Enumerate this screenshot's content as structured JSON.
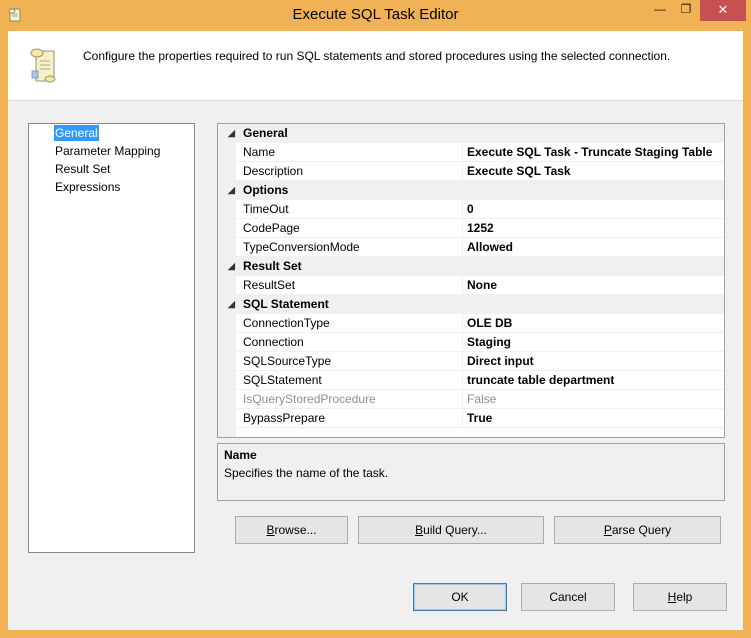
{
  "window": {
    "title": "Execute SQL Task Editor",
    "minimize_glyph": "—",
    "maximize_glyph": "❐",
    "close_glyph": "✕"
  },
  "header": {
    "description": "Configure the properties required to run SQL statements and stored procedures using the selected connection.",
    "icon": "sql-task-scroll-icon"
  },
  "nav": {
    "items": [
      {
        "label": "General",
        "selected": true
      },
      {
        "label": "Parameter Mapping",
        "selected": false
      },
      {
        "label": "Result Set",
        "selected": false
      },
      {
        "label": "Expressions",
        "selected": false
      }
    ]
  },
  "grid": {
    "categories": [
      {
        "label": "General",
        "expanded_glyph": "◢"
      },
      {
        "label": "Options",
        "expanded_glyph": "◢"
      },
      {
        "label": "Result Set",
        "expanded_glyph": "◢"
      },
      {
        "label": "SQL Statement",
        "expanded_glyph": "◢"
      }
    ],
    "props": [
      {
        "name": "Name",
        "value": "Execute SQL Task - Truncate Staging Table"
      },
      {
        "name": "Description",
        "value": "Execute SQL Task"
      },
      {
        "name": "TimeOut",
        "value": "0"
      },
      {
        "name": "CodePage",
        "value": "1252"
      },
      {
        "name": "TypeConversionMode",
        "value": "Allowed"
      },
      {
        "name": "ResultSet",
        "value": "None"
      },
      {
        "name": "ConnectionType",
        "value": "OLE DB"
      },
      {
        "name": "Connection",
        "value": "Staging"
      },
      {
        "name": "SQLSourceType",
        "value": "Direct input"
      },
      {
        "name": "SQLStatement",
        "value": "truncate table department"
      },
      {
        "name": "IsQueryStoredProcedure",
        "value": "False",
        "disabled": true
      },
      {
        "name": "BypassPrepare",
        "value": "True"
      }
    ]
  },
  "description_panel": {
    "title": "Name",
    "text": "Specifies the name of the task."
  },
  "buttons": {
    "browse": {
      "accel": "B",
      "rest": "rowse..."
    },
    "build_query": {
      "accel": "B",
      "rest": "uild Query..."
    },
    "parse_query": {
      "accel": "P",
      "rest": "arse Query"
    },
    "ok": "OK",
    "cancel": "Cancel",
    "help": {
      "accel": "H",
      "rest": "elp"
    }
  },
  "colors": {
    "title_bar": "#f0b254",
    "close_button": "#c75050",
    "selection": "#3399ff"
  }
}
